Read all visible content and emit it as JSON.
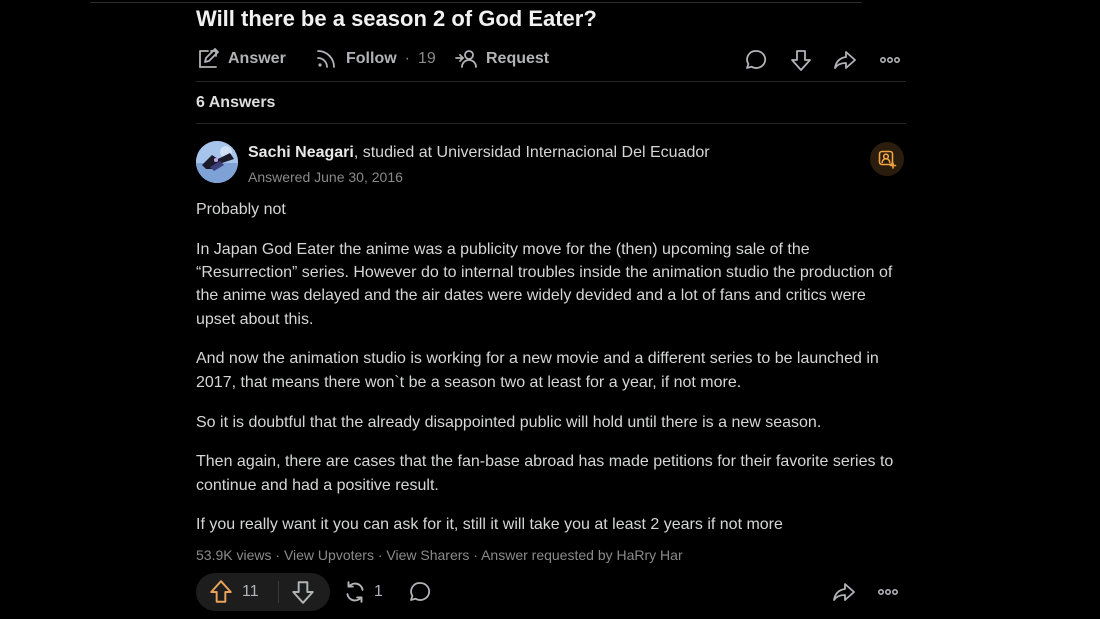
{
  "question": {
    "title": "Will there be a season 2 of God Eater?",
    "actions": {
      "answer_label": "Answer",
      "follow_label": "Follow",
      "follow_separator": "·",
      "follow_count": "19",
      "request_label": "Request"
    }
  },
  "answers_header": "6 Answers",
  "answer": {
    "author_name": "Sachi Neagari",
    "author_credential": ", studied at Universidad Internacional Del Ecuador",
    "answered_date": "Answered June 30, 2016",
    "paragraphs": [
      "Probably not",
      "In Japan God Eater the anime was a publicity move for the (then) upcoming sale of the “Resurrection” series. However do to internal troubles inside the animation studio the production of the anime was delayed and the air dates were widely devided and a lot of fans and critics were upset about this.",
      "And now the animation studio is working for a new movie and a different series to be launched in 2017, that means there won`t be a season two at least for a year, if not more.",
      "So it is doubtful that the already disappointed public will hold until there is a new season.",
      "Then again, there are cases that the fan-base abroad has made petitions for their favorite series to continue and had a positive result.",
      "If you really want it you can ask for it, still it will take you at least 2 years if not more"
    ],
    "stats": {
      "views": "53.9K views",
      "sep1": " · ",
      "view_upvoters": "View Upvoters",
      "sep2": " · ",
      "view_sharers": "View Sharers",
      "sep3": " · ",
      "requested_by": "Answer requested by HaRry Har"
    },
    "upvote_count": "11",
    "share_count": "1"
  },
  "colors": {
    "background": "#000000",
    "text": "#d5d6d6",
    "muted": "#8a8a8a",
    "upvote_accent": "#e8a35a",
    "request_accent": "#f0a545"
  },
  "icons": [
    "pen-square-icon",
    "follow-rss-icon",
    "request-person-icon",
    "comment-icon",
    "downvote-arrow-icon",
    "share-forward-icon",
    "more-dots-icon",
    "request-badge-icon",
    "upvote-arrow-icon",
    "reshare-icon"
  ]
}
